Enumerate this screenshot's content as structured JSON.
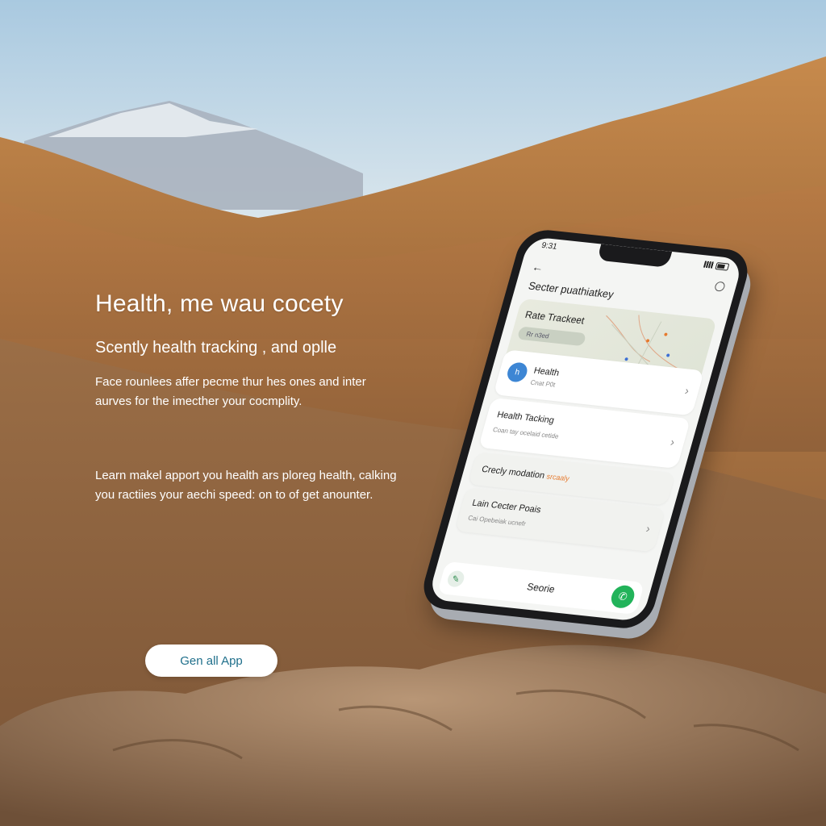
{
  "hero": {
    "headline": "Health, me wau cocety",
    "subheadline": "Scently health tracking  , and oplle",
    "paragraph_1": "Face rounlees affer pecme thur hes ones and inter aurves for the imecther your cocmplity.",
    "paragraph_2": "Learn makel apport you health ars ploreg health, calking you ractiies your aechi speed: on to of get anounter.",
    "cta_label": "Gen all App"
  },
  "phone": {
    "status": {
      "time": "9:31"
    },
    "app_title": "Secter puathiatkey",
    "map": {
      "title": "Rate Trackeet",
      "chip": "Rr n3ed"
    },
    "cards": {
      "health": {
        "title": "Health",
        "sub": "Cnat P0t",
        "icon_text": "h"
      },
      "tracking": {
        "title": "Health Tacking",
        "sub": "Coan tay ocelaid cetide"
      },
      "cozy": {
        "title": "Crecly modation",
        "accent": "srcaaly"
      },
      "coach": {
        "title": "Lain Cecter Poais",
        "sub": "Cai Opebeiak ucnefr"
      }
    },
    "bottom": {
      "label": "Seorie"
    }
  },
  "colors": {
    "accent_orange": "#e67a2e",
    "call_green": "#22b35a",
    "health_blue": "#3d86d4",
    "cta_text": "#1f6f8b"
  }
}
